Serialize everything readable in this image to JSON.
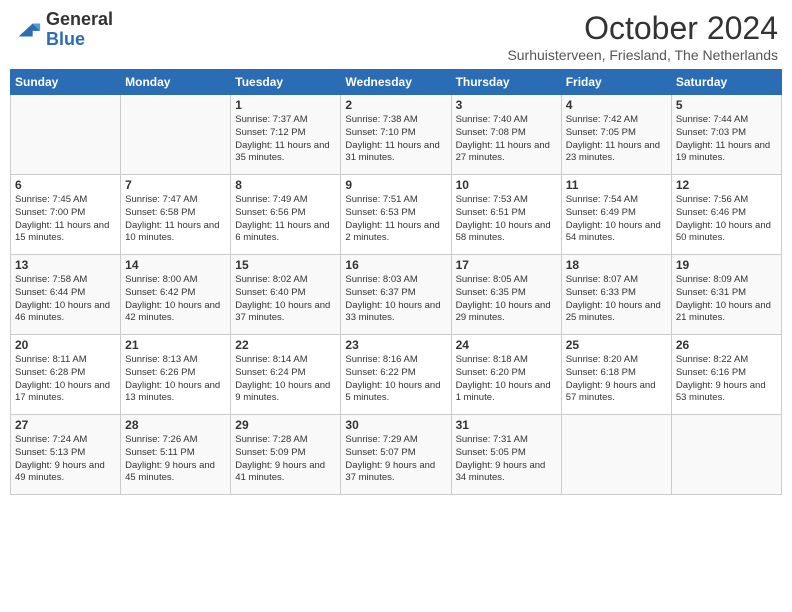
{
  "header": {
    "logo_general": "General",
    "logo_blue": "Blue",
    "month_title": "October 2024",
    "subtitle": "Surhuisterveen, Friesland, The Netherlands"
  },
  "weekdays": [
    "Sunday",
    "Monday",
    "Tuesday",
    "Wednesday",
    "Thursday",
    "Friday",
    "Saturday"
  ],
  "weeks": [
    [
      {
        "day": "",
        "content": ""
      },
      {
        "day": "",
        "content": ""
      },
      {
        "day": "1",
        "content": "Sunrise: 7:37 AM\nSunset: 7:12 PM\nDaylight: 11 hours and 35 minutes."
      },
      {
        "day": "2",
        "content": "Sunrise: 7:38 AM\nSunset: 7:10 PM\nDaylight: 11 hours and 31 minutes."
      },
      {
        "day": "3",
        "content": "Sunrise: 7:40 AM\nSunset: 7:08 PM\nDaylight: 11 hours and 27 minutes."
      },
      {
        "day": "4",
        "content": "Sunrise: 7:42 AM\nSunset: 7:05 PM\nDaylight: 11 hours and 23 minutes."
      },
      {
        "day": "5",
        "content": "Sunrise: 7:44 AM\nSunset: 7:03 PM\nDaylight: 11 hours and 19 minutes."
      }
    ],
    [
      {
        "day": "6",
        "content": "Sunrise: 7:45 AM\nSunset: 7:00 PM\nDaylight: 11 hours and 15 minutes."
      },
      {
        "day": "7",
        "content": "Sunrise: 7:47 AM\nSunset: 6:58 PM\nDaylight: 11 hours and 10 minutes."
      },
      {
        "day": "8",
        "content": "Sunrise: 7:49 AM\nSunset: 6:56 PM\nDaylight: 11 hours and 6 minutes."
      },
      {
        "day": "9",
        "content": "Sunrise: 7:51 AM\nSunset: 6:53 PM\nDaylight: 11 hours and 2 minutes."
      },
      {
        "day": "10",
        "content": "Sunrise: 7:53 AM\nSunset: 6:51 PM\nDaylight: 10 hours and 58 minutes."
      },
      {
        "day": "11",
        "content": "Sunrise: 7:54 AM\nSunset: 6:49 PM\nDaylight: 10 hours and 54 minutes."
      },
      {
        "day": "12",
        "content": "Sunrise: 7:56 AM\nSunset: 6:46 PM\nDaylight: 10 hours and 50 minutes."
      }
    ],
    [
      {
        "day": "13",
        "content": "Sunrise: 7:58 AM\nSunset: 6:44 PM\nDaylight: 10 hours and 46 minutes."
      },
      {
        "day": "14",
        "content": "Sunrise: 8:00 AM\nSunset: 6:42 PM\nDaylight: 10 hours and 42 minutes."
      },
      {
        "day": "15",
        "content": "Sunrise: 8:02 AM\nSunset: 6:40 PM\nDaylight: 10 hours and 37 minutes."
      },
      {
        "day": "16",
        "content": "Sunrise: 8:03 AM\nSunset: 6:37 PM\nDaylight: 10 hours and 33 minutes."
      },
      {
        "day": "17",
        "content": "Sunrise: 8:05 AM\nSunset: 6:35 PM\nDaylight: 10 hours and 29 minutes."
      },
      {
        "day": "18",
        "content": "Sunrise: 8:07 AM\nSunset: 6:33 PM\nDaylight: 10 hours and 25 minutes."
      },
      {
        "day": "19",
        "content": "Sunrise: 8:09 AM\nSunset: 6:31 PM\nDaylight: 10 hours and 21 minutes."
      }
    ],
    [
      {
        "day": "20",
        "content": "Sunrise: 8:11 AM\nSunset: 6:28 PM\nDaylight: 10 hours and 17 minutes."
      },
      {
        "day": "21",
        "content": "Sunrise: 8:13 AM\nSunset: 6:26 PM\nDaylight: 10 hours and 13 minutes."
      },
      {
        "day": "22",
        "content": "Sunrise: 8:14 AM\nSunset: 6:24 PM\nDaylight: 10 hours and 9 minutes."
      },
      {
        "day": "23",
        "content": "Sunrise: 8:16 AM\nSunset: 6:22 PM\nDaylight: 10 hours and 5 minutes."
      },
      {
        "day": "24",
        "content": "Sunrise: 8:18 AM\nSunset: 6:20 PM\nDaylight: 10 hours and 1 minute."
      },
      {
        "day": "25",
        "content": "Sunrise: 8:20 AM\nSunset: 6:18 PM\nDaylight: 9 hours and 57 minutes."
      },
      {
        "day": "26",
        "content": "Sunrise: 8:22 AM\nSunset: 6:16 PM\nDaylight: 9 hours and 53 minutes."
      }
    ],
    [
      {
        "day": "27",
        "content": "Sunrise: 7:24 AM\nSunset: 5:13 PM\nDaylight: 9 hours and 49 minutes."
      },
      {
        "day": "28",
        "content": "Sunrise: 7:26 AM\nSunset: 5:11 PM\nDaylight: 9 hours and 45 minutes."
      },
      {
        "day": "29",
        "content": "Sunrise: 7:28 AM\nSunset: 5:09 PM\nDaylight: 9 hours and 41 minutes."
      },
      {
        "day": "30",
        "content": "Sunrise: 7:29 AM\nSunset: 5:07 PM\nDaylight: 9 hours and 37 minutes."
      },
      {
        "day": "31",
        "content": "Sunrise: 7:31 AM\nSunset: 5:05 PM\nDaylight: 9 hours and 34 minutes."
      },
      {
        "day": "",
        "content": ""
      },
      {
        "day": "",
        "content": ""
      }
    ]
  ]
}
